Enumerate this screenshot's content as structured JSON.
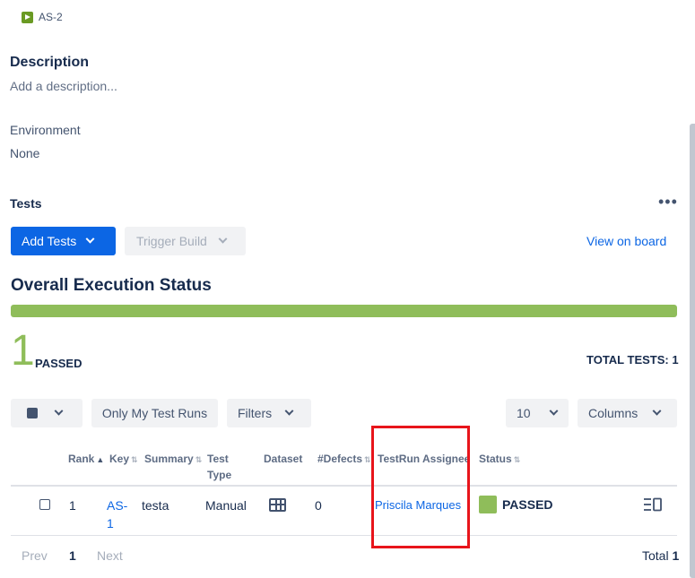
{
  "issue": {
    "key": "AS-2",
    "icon": "test-execution-icon",
    "icon_color": "#6a9a23"
  },
  "description": {
    "heading": "Description",
    "placeholder": "Add a description..."
  },
  "environment": {
    "heading": "Environment",
    "value": "None"
  },
  "tests": {
    "heading": "Tests",
    "more_icon": "more-horizontal-icon",
    "add_tests_label": "Add Tests",
    "trigger_build_label": "Trigger Build",
    "view_on_board_label": "View on board"
  },
  "overall": {
    "heading": "Overall Execution Status",
    "passed_fraction": 1.0,
    "passed_count": "1",
    "passed_label": "PASSED",
    "total_label": "TOTAL TESTS: 1",
    "colors": {
      "passed": "#8fbd5a",
      "primary": "#0c66e4"
    }
  },
  "toolbar": {
    "only_my_test_runs": "Only My Test Runs",
    "filters": "Filters",
    "page_size": "10",
    "columns": "Columns"
  },
  "table": {
    "headers": {
      "rank": "Rank",
      "key": "Key",
      "summary": "Summary",
      "test_type": [
        "Test",
        "Type"
      ],
      "dataset": "Dataset",
      "defects": "#Defects",
      "assignee": "TestRun Assignee",
      "status": "Status"
    },
    "rows": [
      {
        "rank": "1",
        "key": [
          "AS-",
          "1"
        ],
        "summary": "testa",
        "test_type": "Manual",
        "dataset_icon": "table-grid-icon",
        "defects": "0",
        "assignee": "Priscila Marques",
        "status": "PASSED",
        "status_color": "#8fbd5a",
        "detail_icon": "detail-view-icon"
      }
    ]
  },
  "pagination": {
    "prev": "Prev",
    "current": "1",
    "next": "Next",
    "total_label": "Total",
    "total_value": "1"
  },
  "annotation": {
    "highlight_color": "#e8141b"
  }
}
